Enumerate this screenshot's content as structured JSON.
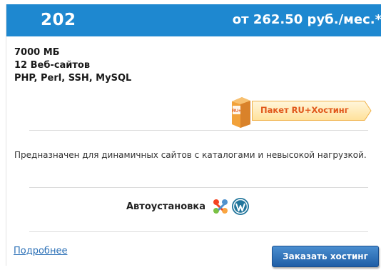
{
  "plan": {
    "number": "202",
    "price": "от 262.50 руб./мес.*"
  },
  "specs": {
    "disk": "7000 МБ",
    "sites": "12 Веб-сайтов",
    "tech": "PHP, Perl, SSH, MySQL"
  },
  "package": {
    "box_text": "RU+",
    "label": "Пакет RU+Хостинг"
  },
  "description": "Предназначен для динамичных сайтов с каталогами и невысокой нагрузкой.",
  "autoinstall": {
    "label": "Автоустановка",
    "icons": [
      "joomla-icon",
      "wordpress-icon"
    ]
  },
  "actions": {
    "more_label": "Подробнее",
    "order_label": "Заказать хостинг"
  },
  "colors": {
    "header_bg": "#1e88d0",
    "accent_orange": "#e0561a",
    "link_blue": "#2a6fb6",
    "button_blue": "#1f5ea6"
  }
}
